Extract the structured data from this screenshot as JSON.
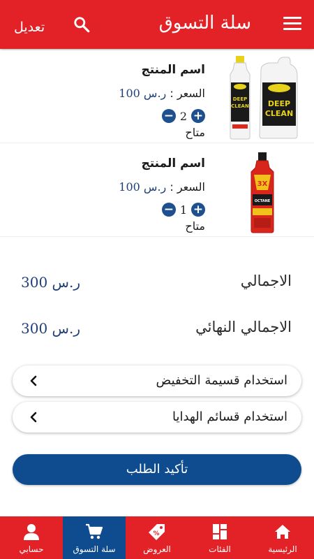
{
  "header": {
    "title": "سلة التسوق",
    "edit_label": "تعديل",
    "menu_icon": "menu-icon",
    "search_icon": "search-icon",
    "color": "#e32227"
  },
  "cart": {
    "items": [
      {
        "name": "اسم المنتج",
        "price_label": "السعر :",
        "price_value": "ر.س 100",
        "quantity": "2",
        "availability": "متاح",
        "image": "diesel-deep-clean-bottles"
      },
      {
        "name": "اسم المنتج",
        "price_label": "السعر :",
        "price_value": "ر.س 100",
        "quantity": "1",
        "availability": "متاح",
        "image": "octane-booster-bottle"
      }
    ]
  },
  "totals": {
    "subtotal_label": "الاجمالي",
    "subtotal_value": "ر.س 300",
    "final_label": "الاجمالي النهائي",
    "final_value": "ر.س 300"
  },
  "options": {
    "discount_label": "استخدام قسيمة التخفيض",
    "gift_label": "استخدام قسائم الهدايا"
  },
  "confirm_label": "تأكيد الطلب",
  "bottom_nav": {
    "items": [
      {
        "label": "الرئيسية",
        "icon": "home-icon"
      },
      {
        "label": "الفئات",
        "icon": "categories-icon"
      },
      {
        "label": "العروض",
        "icon": "offers-tag-icon"
      },
      {
        "label": "سلة التسوق",
        "icon": "cart-icon",
        "active": true
      },
      {
        "label": "حسابي",
        "icon": "account-icon"
      }
    ]
  },
  "colors": {
    "primary_red": "#e32227",
    "primary_blue": "#0f4c8f",
    "price_blue": "#1e3f78"
  }
}
